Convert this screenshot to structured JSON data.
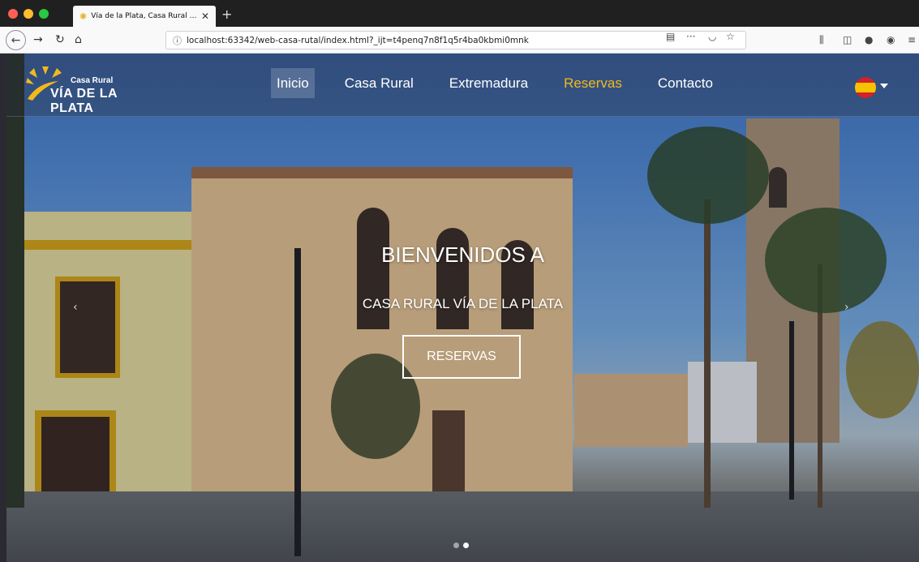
{
  "browser": {
    "tab_title": "Vía de la Plata, Casa Rural en E",
    "url": "localhost:63342/web-casa-rutal/index.html?_ijt=t4penq7n8f1q5r4ba0kbmi0mnk",
    "colors": {
      "close": "#ff5f57",
      "minimize": "#febc2e",
      "maximize": "#28c840"
    }
  },
  "site": {
    "logo_small": "Casa Rural",
    "logo_big": "VÍA DE LA PLATA",
    "nav": [
      {
        "label": "Inicio"
      },
      {
        "label": "Casa Rural"
      },
      {
        "label": "Extremadura"
      },
      {
        "label": "Reservas"
      },
      {
        "label": "Contacto"
      }
    ],
    "accent": "#f2b91d"
  },
  "hero": {
    "title": "BIENVENIDOS A",
    "subtitle": "CASA RURAL VÍA DE LA PLATA",
    "button": "RESERVAS",
    "prev": "‹",
    "next": "›",
    "active_slide": 2,
    "slides": 2
  }
}
